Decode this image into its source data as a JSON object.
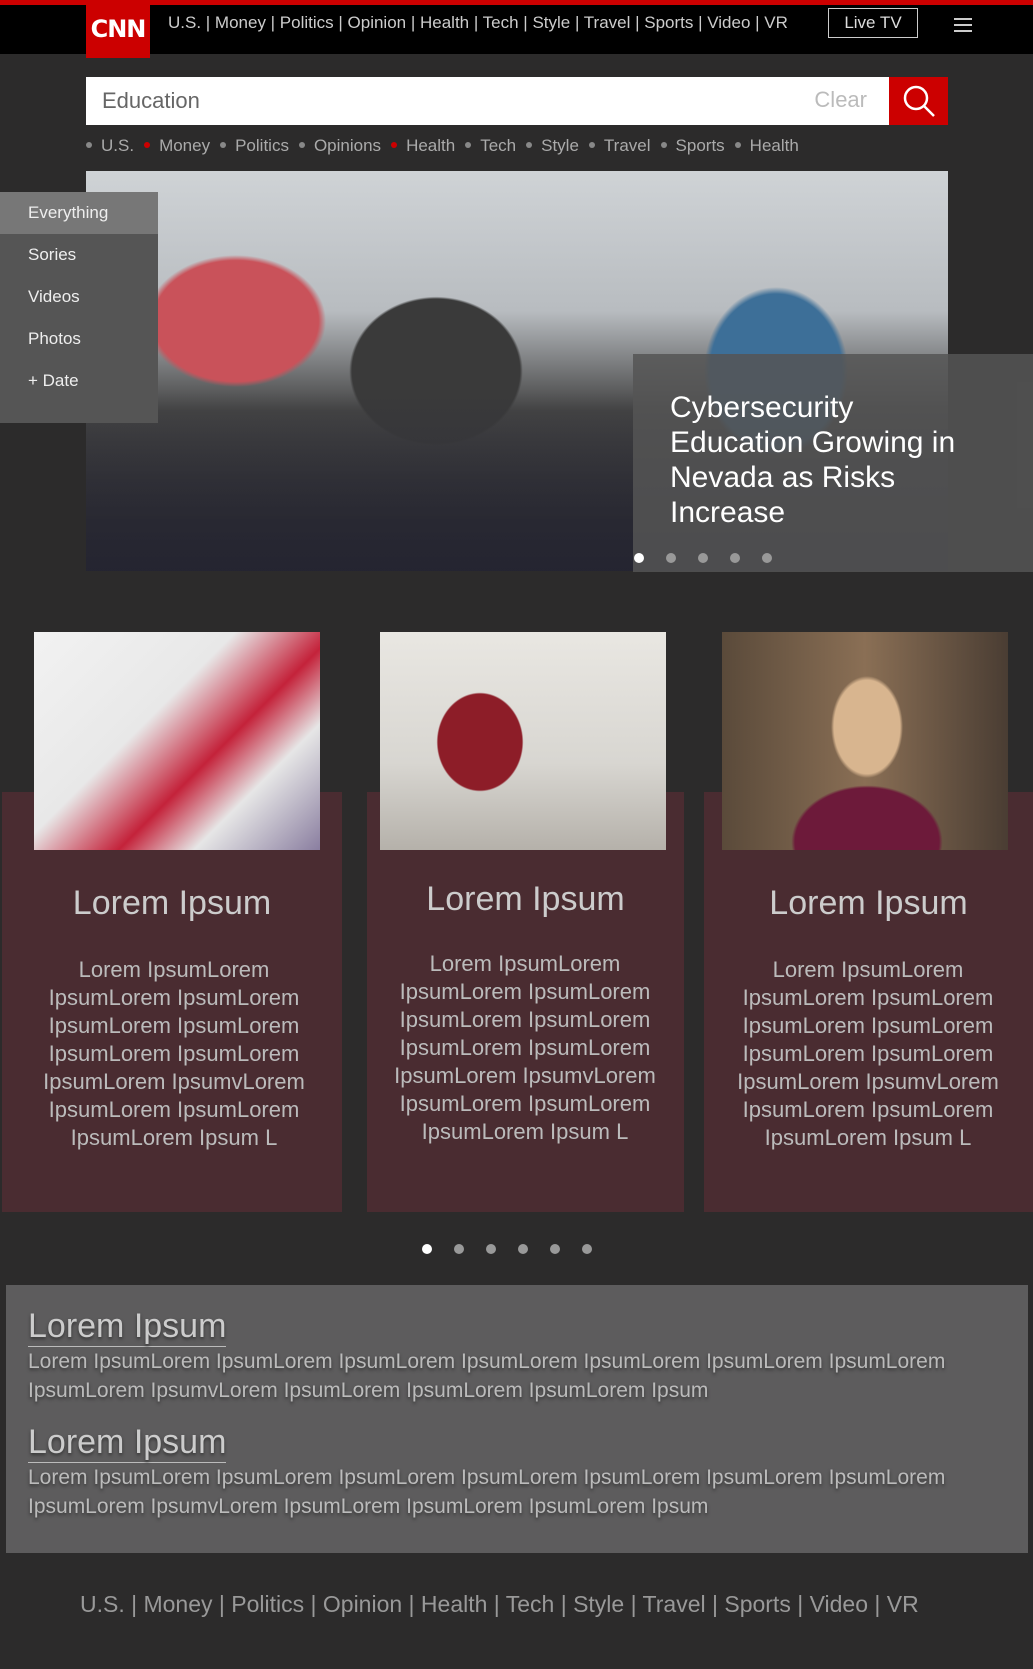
{
  "header": {
    "logo_text": "CNN",
    "nav_text": "U.S. | Money | Politics | Opinion | Health | Tech | Style | Travel | Sports | Video | VR",
    "live_tv_label": "Live TV",
    "menu_icon": "hamburger-icon"
  },
  "search": {
    "value": "Education",
    "clear_label": "Clear",
    "button_icon": "search-icon"
  },
  "categories": [
    {
      "label": "U.S.",
      "dot": "gray"
    },
    {
      "label": "Money",
      "dot": "red"
    },
    {
      "label": "Politics",
      "dot": "gray"
    },
    {
      "label": "Opinions",
      "dot": "gray"
    },
    {
      "label": "Health",
      "dot": "red"
    },
    {
      "label": "Tech",
      "dot": "gray"
    },
    {
      "label": "Style",
      "dot": "gray"
    },
    {
      "label": "Travel",
      "dot": "gray"
    },
    {
      "label": "Sports",
      "dot": "gray"
    },
    {
      "label": "Health",
      "dot": "gray"
    }
  ],
  "filter": {
    "items": [
      "Everything",
      "Sories",
      "Videos",
      "Photos",
      "+ Date"
    ],
    "active": "Everything"
  },
  "hero": {
    "caption": "Cybersecurity Education Growing in Nevada as Risks Increase",
    "slide_count": 5,
    "active_slide": 1
  },
  "cards": [
    {
      "title": "Lorem Ipsum",
      "body": "Lorem IpsumLorem IpsumLorem IpsumLorem IpsumLorem IpsumLorem IpsumLorem IpsumLorem IpsumLorem IpsumvLorem IpsumLorem IpsumLorem IpsumLorem Ipsum L"
    },
    {
      "title": "Lorem Ipsum",
      "body": "Lorem IpsumLorem IpsumLorem IpsumLorem IpsumLorem IpsumLorem IpsumLorem IpsumLorem IpsumLorem IpsumvLorem IpsumLorem IpsumLorem IpsumLorem Ipsum L"
    },
    {
      "title": "Lorem Ipsum",
      "body": "Lorem IpsumLorem IpsumLorem IpsumLorem IpsumLorem IpsumLorem IpsumLorem IpsumLorem IpsumLorem IpsumvLorem IpsumLorem IpsumLorem IpsumLorem Ipsum L"
    }
  ],
  "cards_carousel": {
    "slide_count": 6,
    "active_slide": 1
  },
  "articles": [
    {
      "title": "Lorem Ipsum",
      "body": "Lorem IpsumLorem IpsumLorem IpsumLorem IpsumLorem IpsumLorem IpsumLorem IpsumLorem IpsumLorem IpsumvLorem IpsumLorem IpsumLorem IpsumLorem Ipsum"
    },
    {
      "title": "Lorem Ipsum",
      "body": "Lorem IpsumLorem IpsumLorem IpsumLorem IpsumLorem IpsumLorem IpsumLorem IpsumLorem IpsumLorem IpsumvLorem IpsumLorem IpsumLorem IpsumLorem Ipsum"
    }
  ],
  "footer": {
    "nav_text": "U.S. | Money | Politics | Opinion | Health | Tech | Style | Travel | Sports | Video | VR"
  },
  "colors": {
    "brand_red": "#cc0000",
    "card_bg": "#4a2c31",
    "page_bg": "#2c2b2b"
  }
}
